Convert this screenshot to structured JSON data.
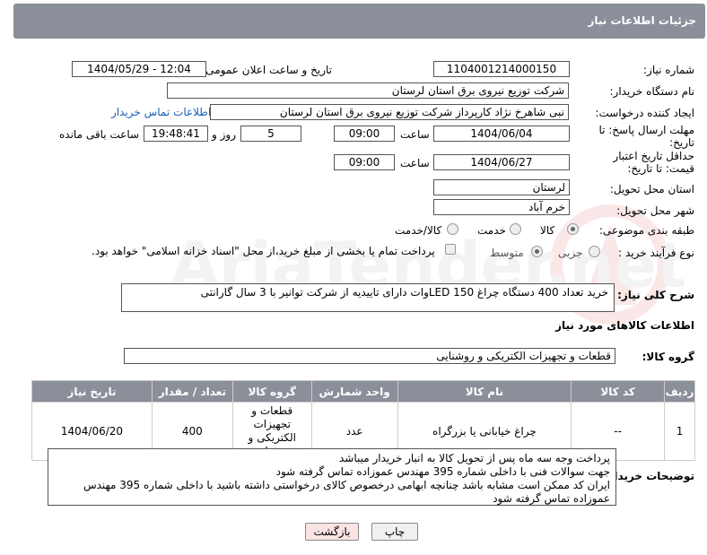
{
  "header": {
    "title": "جزئیات اطلاعات نیاز"
  },
  "fields": {
    "need_number_label": "شماره نیاز:",
    "need_number": "1104001214000150",
    "announce_label": "تاریخ و ساعت اعلان عمومی:",
    "announce_value": "1404/05/29 - 12:04",
    "buyer_org_label": "نام دستگاه خریدار:",
    "buyer_org": "شرکت توزیع نیروی برق استان لرستان",
    "requester_label": "ایجاد کننده درخواست:",
    "requester": "نبی شاهرخ نژاد کارپرداز شرکت توزیع نیروی برق استان لرستان",
    "buyer_contact_link": "اطلاعات تماس خریدار",
    "reply_deadline_label": "مهلت ارسال پاسخ: تا تاریخ:",
    "reply_date": "1404/06/04",
    "time_label": "ساعت",
    "reply_time": "09:00",
    "days_value": "5",
    "days_label": "روز و",
    "remaining_time": "19:48:41",
    "remaining_label": "ساعت باقی مانده",
    "price_validity_label": "حداقل تاریخ اعتبار قیمت: تا تاریخ:",
    "price_date": "1404/06/27",
    "price_time": "09:00",
    "province_label": "استان محل تحویل:",
    "province": "لرستان",
    "city_label": "شهر محل تحویل:",
    "city": "خرم آباد",
    "category_label": "طبقه بندی موضوعی:",
    "category_options": [
      "کالا",
      "خدمت",
      "کالا/خدمت"
    ],
    "process_label": "نوع فرآیند خرید :",
    "process_options": [
      "جزیی",
      "متوسط"
    ],
    "payment_text": "پرداخت تمام یا بخشی از مبلغ خرید،از محل \"اسناد خزانه اسلامی\" خواهد بود.",
    "description_label": "شرح کلی نیاز:",
    "description": "خرید تعداد 400 دستگاه چراغ  LED 150وات  دارای تاییدیه از شرکت توانیر با 3 سال گارانتی"
  },
  "goods": {
    "section_title": "اطلاعات کالاهای مورد نیاز",
    "group_label": "گروه کالا:",
    "group_value": "قطعات و تجهیزات الکتریکی و روشنایی",
    "columns": [
      "ردیف",
      "کد کالا",
      "نام کالا",
      "واحد شمارش",
      "گروه کالا",
      "تعداد / مقدار",
      "تاریخ نیاز"
    ],
    "rows": [
      {
        "index": "1",
        "code": "--",
        "name": "چراغ خیابانی یا بزرگراه",
        "unit": "عدد",
        "group": "قطعات و تجهیزات الکتریکی و روشنایی",
        "quantity": "400",
        "date": "1404/06/20"
      }
    ]
  },
  "notes": {
    "label": "توضیحات خریدار:",
    "lines": [
      "پرداخت وجه سه ماه پس از تحویل کالا  به انبار خریدار میباشد",
      "جهت سوالات فنی با داخلی شماره 395 مهندس عموزاده تماس گرفته شود",
      "ایران کد ممکن است مشابه باشد چنانچه ابهامی درخصوص کالای درخواستی داشته باشید با داخلی شماره 395 مهندس",
      "عموزاده تماس گرفته شود"
    ]
  },
  "buttons": {
    "print": "چاپ",
    "back": "بازگشت"
  },
  "watermark": {
    "text": "AriaTender.net"
  },
  "colors": {
    "header_bg": "#8a8f99",
    "link": "#1a5fb4",
    "back_button_bg": "#fbe3e3"
  }
}
